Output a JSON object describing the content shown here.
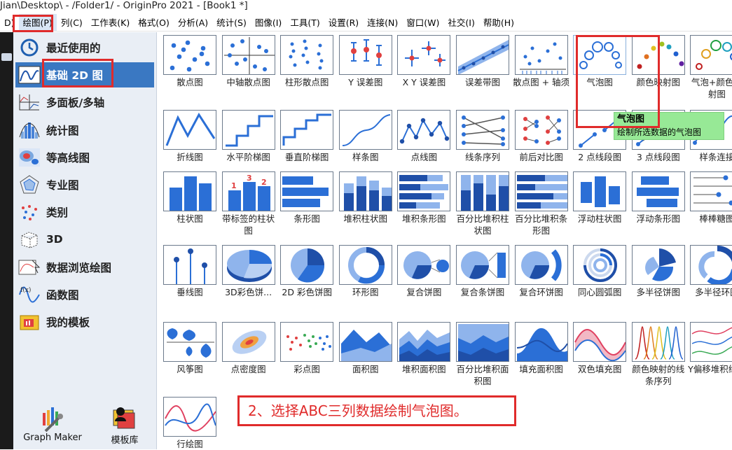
{
  "window": {
    "title": "Jian\\Desktop\\ - /Folder1/ - OriginPro 2021 - [Book1 *]"
  },
  "menubar": {
    "items": [
      {
        "label": "D)"
      },
      {
        "label": "绘图(P)",
        "active": true
      },
      {
        "label": "列(C)"
      },
      {
        "label": "工作表(K)"
      },
      {
        "label": "格式(O)"
      },
      {
        "label": "分析(A)"
      },
      {
        "label": "统计(S)"
      },
      {
        "label": "图像(I)"
      },
      {
        "label": "工具(T)"
      },
      {
        "label": "设置(R)"
      },
      {
        "label": "连接(N)"
      },
      {
        "label": "窗口(W)"
      },
      {
        "label": "社交(I)"
      },
      {
        "label": "帮助(H)"
      }
    ]
  },
  "sidebar": {
    "categories": [
      {
        "label": "最近使用的",
        "icon": "clock-icon"
      },
      {
        "label": "基础 2D 图",
        "icon": "line-graph-icon",
        "selected": true
      },
      {
        "label": "多面板/多轴",
        "icon": "multi-panel-icon"
      },
      {
        "label": "统计图",
        "icon": "histogram-icon"
      },
      {
        "label": "等高线图",
        "icon": "contour-icon"
      },
      {
        "label": "专业图",
        "icon": "pentagon-icon"
      },
      {
        "label": "类别",
        "icon": "category-scatter-icon"
      },
      {
        "label": "3D",
        "icon": "cube-icon"
      },
      {
        "label": "数据浏览绘图",
        "icon": "data-browser-icon"
      },
      {
        "label": "函数图",
        "icon": "function-icon"
      },
      {
        "label": "我的模板",
        "icon": "template-folder-icon"
      }
    ],
    "bottom_tools": [
      {
        "label": "Graph Maker",
        "icon": "graph-maker-icon"
      },
      {
        "label": "模板库",
        "icon": "template-library-icon"
      }
    ]
  },
  "grid": {
    "rows": [
      [
        {
          "label": "散点图",
          "icon": "scatter"
        },
        {
          "label": "中轴散点图",
          "icon": "center-scatter"
        },
        {
          "label": "柱形散点图",
          "icon": "column-scatter"
        },
        {
          "label": "Y 误差图",
          "icon": "y-error"
        },
        {
          "label": "X Y 误差图",
          "icon": "xy-error"
        },
        {
          "label": "误差带图",
          "icon": "error-band"
        },
        {
          "label": "散点图 + 轴须",
          "icon": "scatter-rug"
        },
        {
          "label": "气泡图",
          "icon": "bubble",
          "hover": true
        },
        {
          "label": "颜色映射图",
          "icon": "color-map"
        },
        {
          "label": "气泡+颜色映射图",
          "icon": "bubble-color"
        }
      ],
      [
        {
          "label": "折线图",
          "icon": "line"
        },
        {
          "label": "水平阶梯图",
          "icon": "h-step"
        },
        {
          "label": "垂直阶梯图",
          "icon": "v-step"
        },
        {
          "label": "样条图",
          "icon": "spline"
        },
        {
          "label": "点线图",
          "icon": "line-symbol"
        },
        {
          "label": "线条序列",
          "icon": "line-series"
        },
        {
          "label": "前后对比图",
          "icon": "before-after"
        },
        {
          "label": "2 点线段图",
          "icon": "two-point"
        },
        {
          "label": "3 点线段图",
          "icon": "three-point"
        },
        {
          "label": "样条连接",
          "icon": "spline-connect"
        }
      ],
      [
        {
          "label": "柱状图",
          "icon": "column"
        },
        {
          "label": "带标签的柱状图",
          "icon": "labeled-column"
        },
        {
          "label": "条形图",
          "icon": "bar"
        },
        {
          "label": "堆积柱状图",
          "icon": "stacked-column"
        },
        {
          "label": "堆积条形图",
          "icon": "stacked-bar"
        },
        {
          "label": "百分比堆积柱状图",
          "icon": "pct-stacked-column"
        },
        {
          "label": "百分比堆积条形图",
          "icon": "pct-stacked-bar"
        },
        {
          "label": "浮动柱状图",
          "icon": "floating-column"
        },
        {
          "label": "浮动条形图",
          "icon": "floating-bar"
        },
        {
          "label": "棒棒糖图",
          "icon": "lollipop"
        }
      ],
      [
        {
          "label": "垂线图",
          "icon": "drop-line"
        },
        {
          "label": "3D彩色饼...",
          "icon": "pie3d"
        },
        {
          "label": "2D 彩色饼图",
          "icon": "pie2d"
        },
        {
          "label": "环形图",
          "icon": "doughnut"
        },
        {
          "label": "复合饼图",
          "icon": "pie-of-pie"
        },
        {
          "label": "复合条饼图",
          "icon": "bar-of-pie"
        },
        {
          "label": "复合环饼图",
          "icon": "ring-pie"
        },
        {
          "label": "同心圆弧图",
          "icon": "concentric-arc"
        },
        {
          "label": "多半径饼图",
          "icon": "multi-radius-pie"
        },
        {
          "label": "多半径环图",
          "icon": "multi-radius-ring"
        }
      ],
      [
        {
          "label": "风筝图",
          "icon": "kite"
        },
        {
          "label": "点密度图",
          "icon": "density-dots"
        },
        {
          "label": "彩点图",
          "icon": "color-dots"
        },
        {
          "label": "面积图",
          "icon": "area"
        },
        {
          "label": "堆积面积图",
          "icon": "stacked-area"
        },
        {
          "label": "百分比堆积面积图",
          "icon": "pct-stacked-area"
        },
        {
          "label": "填充面积图",
          "icon": "fill-area"
        },
        {
          "label": "双色填充图",
          "icon": "two-color-fill"
        },
        {
          "label": "颜色映射的线条序列",
          "icon": "color-mapped-lines"
        },
        {
          "label": "Y偏移堆积线图",
          "icon": "y-offset-lines"
        }
      ],
      [
        {
          "label": "行绘图",
          "icon": "plot-by-row"
        }
      ]
    ]
  },
  "tooltip": {
    "title": "气泡图",
    "desc": "绘制所选数据的气泡图"
  },
  "annotation": {
    "text": "2、选择ABC三列数据绘制气泡图。"
  },
  "colors": {
    "accent": "#3a78c2",
    "highlight": "#e02b2b",
    "tooltip": "#97e996",
    "chart_blue": "#2b6fd6"
  }
}
